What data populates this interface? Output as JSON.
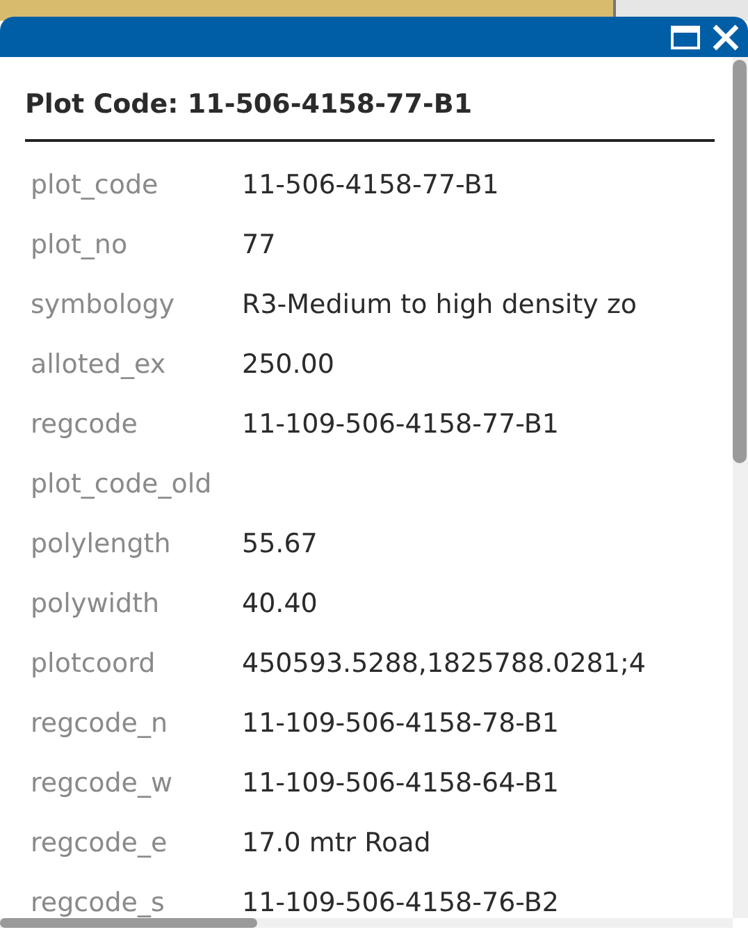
{
  "popup": {
    "title": "Plot Code: 11-506-4158-77-B1",
    "fields": [
      {
        "label": "plot_code",
        "value": "11-506-4158-77-B1"
      },
      {
        "label": "plot_no",
        "value": "77"
      },
      {
        "label": "symbology",
        "value": "R3-Medium to high density zo"
      },
      {
        "label": "alloted_ex",
        "value": "250.00"
      },
      {
        "label": "regcode",
        "value": "11-109-506-4158-77-B1"
      },
      {
        "label": "plot_code_old"
      },
      {
        "label": "polylength",
        "value": "55.67"
      },
      {
        "label": "polywidth",
        "value": "40.40"
      },
      {
        "label": "plotcoord",
        "value": "450593.5288,1825788.0281;4"
      },
      {
        "label": "regcode_n",
        "value": "11-109-506-4158-78-B1"
      },
      {
        "label": "regcode_w",
        "value": "11-109-506-4158-64-B1"
      },
      {
        "label": "regcode_e",
        "value": "17.0 mtr Road"
      },
      {
        "label": "regcode_s",
        "value": "11-109-506-4158-76-B2"
      }
    ]
  }
}
